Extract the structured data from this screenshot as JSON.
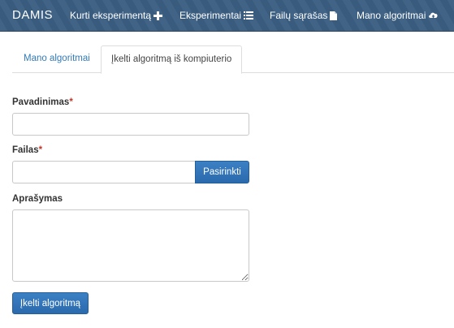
{
  "navbar": {
    "brand": "DAMIS",
    "items": [
      {
        "label": "Kurti eksperimentą",
        "icon": "plus-icon"
      },
      {
        "label": "Eksperimentai",
        "icon": "list-icon"
      },
      {
        "label": "Failų sąrašas",
        "icon": "file-icon"
      },
      {
        "label": "Mano algoritmai",
        "icon": "cloud-upload-icon"
      }
    ],
    "background_color": "#3a5e82"
  },
  "tabs": [
    {
      "label": "Mano algoritmai",
      "active": false
    },
    {
      "label": "Įkelti algoritmą iš kompiuterio",
      "active": true
    }
  ],
  "form": {
    "name_label": "Pavadinimas",
    "name_value": "",
    "file_label": "Failas",
    "file_value": "",
    "browse_label": "Pasirinkti",
    "description_label": "Aprašymas",
    "description_value": "",
    "required_marker": "*",
    "submit_label": "Įkelti algoritmą"
  },
  "colors": {
    "accent": "#2a6aad",
    "link": "#337ab7",
    "required": "#c0392b"
  }
}
